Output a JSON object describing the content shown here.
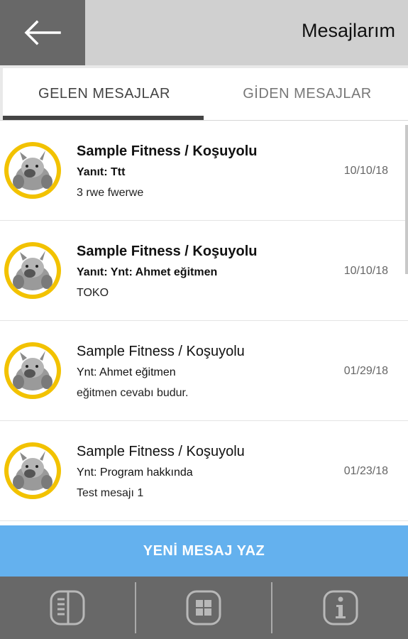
{
  "header": {
    "title": "Mesajlarım",
    "back_icon": "arrow-left-icon"
  },
  "tabs": [
    {
      "label": "GELEN MESAJLAR",
      "active": true
    },
    {
      "label": "GİDEN MESAJLAR",
      "active": false
    }
  ],
  "messages": [
    {
      "sender": "Sample Fitness / Koşuyolu",
      "subject": "Yanıt: Ttt",
      "body": "3 rwe fwerwe",
      "date": "10/10/18",
      "unread": true
    },
    {
      "sender": "Sample Fitness / Koşuyolu",
      "subject": "Yanıt: Ynt: Ahmet eğitmen",
      "body": "TOKO",
      "date": "10/10/18",
      "unread": true
    },
    {
      "sender": "Sample Fitness / Koşuyolu",
      "subject": "Ynt: Ahmet eğitmen",
      "body": "eğitmen cevabı budur.",
      "date": "01/29/18",
      "unread": false
    },
    {
      "sender": "Sample Fitness / Koşuyolu",
      "subject": "Ynt: Program hakkında",
      "body": "Test mesajı 1",
      "date": "01/23/18",
      "unread": false
    }
  ],
  "compose_button": {
    "label": "YENİ MESAJ YAZ"
  },
  "bottom_nav": [
    {
      "icon": "list-panel-icon"
    },
    {
      "icon": "grid-icon"
    },
    {
      "icon": "info-icon"
    }
  ],
  "colors": {
    "header_bg": "#d0d0d0",
    "back_button_bg": "#686868",
    "avatar_ring": "#f2c200",
    "compose_bg": "#64b1ee",
    "nav_bg": "#686868"
  }
}
